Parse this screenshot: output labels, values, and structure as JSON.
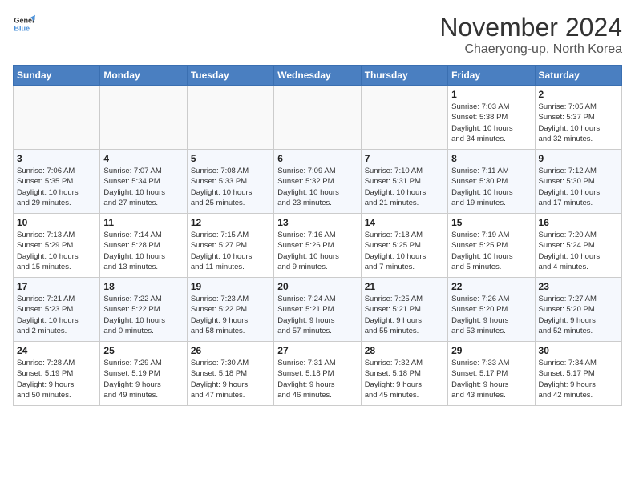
{
  "header": {
    "logo_line1": "General",
    "logo_line2": "Blue",
    "month": "November 2024",
    "location": "Chaeryong-up, North Korea"
  },
  "weekdays": [
    "Sunday",
    "Monday",
    "Tuesday",
    "Wednesday",
    "Thursday",
    "Friday",
    "Saturday"
  ],
  "weeks": [
    [
      {
        "day": "",
        "info": ""
      },
      {
        "day": "",
        "info": ""
      },
      {
        "day": "",
        "info": ""
      },
      {
        "day": "",
        "info": ""
      },
      {
        "day": "",
        "info": ""
      },
      {
        "day": "1",
        "info": "Sunrise: 7:03 AM\nSunset: 5:38 PM\nDaylight: 10 hours\nand 34 minutes."
      },
      {
        "day": "2",
        "info": "Sunrise: 7:05 AM\nSunset: 5:37 PM\nDaylight: 10 hours\nand 32 minutes."
      }
    ],
    [
      {
        "day": "3",
        "info": "Sunrise: 7:06 AM\nSunset: 5:35 PM\nDaylight: 10 hours\nand 29 minutes."
      },
      {
        "day": "4",
        "info": "Sunrise: 7:07 AM\nSunset: 5:34 PM\nDaylight: 10 hours\nand 27 minutes."
      },
      {
        "day": "5",
        "info": "Sunrise: 7:08 AM\nSunset: 5:33 PM\nDaylight: 10 hours\nand 25 minutes."
      },
      {
        "day": "6",
        "info": "Sunrise: 7:09 AM\nSunset: 5:32 PM\nDaylight: 10 hours\nand 23 minutes."
      },
      {
        "day": "7",
        "info": "Sunrise: 7:10 AM\nSunset: 5:31 PM\nDaylight: 10 hours\nand 21 minutes."
      },
      {
        "day": "8",
        "info": "Sunrise: 7:11 AM\nSunset: 5:30 PM\nDaylight: 10 hours\nand 19 minutes."
      },
      {
        "day": "9",
        "info": "Sunrise: 7:12 AM\nSunset: 5:30 PM\nDaylight: 10 hours\nand 17 minutes."
      }
    ],
    [
      {
        "day": "10",
        "info": "Sunrise: 7:13 AM\nSunset: 5:29 PM\nDaylight: 10 hours\nand 15 minutes."
      },
      {
        "day": "11",
        "info": "Sunrise: 7:14 AM\nSunset: 5:28 PM\nDaylight: 10 hours\nand 13 minutes."
      },
      {
        "day": "12",
        "info": "Sunrise: 7:15 AM\nSunset: 5:27 PM\nDaylight: 10 hours\nand 11 minutes."
      },
      {
        "day": "13",
        "info": "Sunrise: 7:16 AM\nSunset: 5:26 PM\nDaylight: 10 hours\nand 9 minutes."
      },
      {
        "day": "14",
        "info": "Sunrise: 7:18 AM\nSunset: 5:25 PM\nDaylight: 10 hours\nand 7 minutes."
      },
      {
        "day": "15",
        "info": "Sunrise: 7:19 AM\nSunset: 5:25 PM\nDaylight: 10 hours\nand 5 minutes."
      },
      {
        "day": "16",
        "info": "Sunrise: 7:20 AM\nSunset: 5:24 PM\nDaylight: 10 hours\nand 4 minutes."
      }
    ],
    [
      {
        "day": "17",
        "info": "Sunrise: 7:21 AM\nSunset: 5:23 PM\nDaylight: 10 hours\nand 2 minutes."
      },
      {
        "day": "18",
        "info": "Sunrise: 7:22 AM\nSunset: 5:22 PM\nDaylight: 10 hours\nand 0 minutes."
      },
      {
        "day": "19",
        "info": "Sunrise: 7:23 AM\nSunset: 5:22 PM\nDaylight: 9 hours\nand 58 minutes."
      },
      {
        "day": "20",
        "info": "Sunrise: 7:24 AM\nSunset: 5:21 PM\nDaylight: 9 hours\nand 57 minutes."
      },
      {
        "day": "21",
        "info": "Sunrise: 7:25 AM\nSunset: 5:21 PM\nDaylight: 9 hours\nand 55 minutes."
      },
      {
        "day": "22",
        "info": "Sunrise: 7:26 AM\nSunset: 5:20 PM\nDaylight: 9 hours\nand 53 minutes."
      },
      {
        "day": "23",
        "info": "Sunrise: 7:27 AM\nSunset: 5:20 PM\nDaylight: 9 hours\nand 52 minutes."
      }
    ],
    [
      {
        "day": "24",
        "info": "Sunrise: 7:28 AM\nSunset: 5:19 PM\nDaylight: 9 hours\nand 50 minutes."
      },
      {
        "day": "25",
        "info": "Sunrise: 7:29 AM\nSunset: 5:19 PM\nDaylight: 9 hours\nand 49 minutes."
      },
      {
        "day": "26",
        "info": "Sunrise: 7:30 AM\nSunset: 5:18 PM\nDaylight: 9 hours\nand 47 minutes."
      },
      {
        "day": "27",
        "info": "Sunrise: 7:31 AM\nSunset: 5:18 PM\nDaylight: 9 hours\nand 46 minutes."
      },
      {
        "day": "28",
        "info": "Sunrise: 7:32 AM\nSunset: 5:18 PM\nDaylight: 9 hours\nand 45 minutes."
      },
      {
        "day": "29",
        "info": "Sunrise: 7:33 AM\nSunset: 5:17 PM\nDaylight: 9 hours\nand 43 minutes."
      },
      {
        "day": "30",
        "info": "Sunrise: 7:34 AM\nSunset: 5:17 PM\nDaylight: 9 hours\nand 42 minutes."
      }
    ]
  ]
}
